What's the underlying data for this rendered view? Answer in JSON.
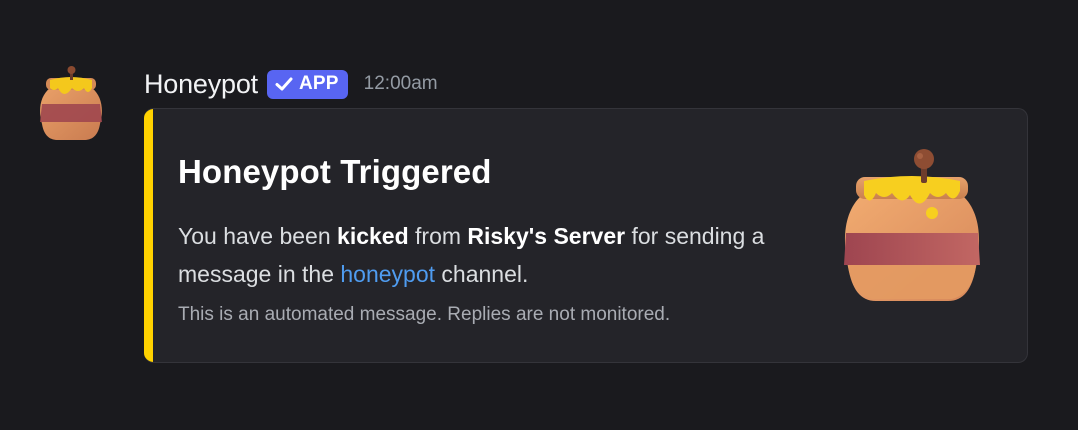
{
  "message": {
    "author": "Honeypot",
    "badge_label": "APP",
    "timestamp": "12:00am",
    "avatar_icon": "honey-pot-icon",
    "embed": {
      "accent_color": "#ffd200",
      "title": "Honeypot Triggered",
      "description": {
        "part1": "You have been ",
        "action": "kicked",
        "part2": " from ",
        "server": "Risky's Server",
        "part3": " for sending a message in the ",
        "channel": "honeypot",
        "part4": " channel."
      },
      "footer": "This is an automated message. Replies are not monitored.",
      "thumbnail_icon": "honey-pot-icon"
    }
  },
  "colors": {
    "background": "#1a1a1e",
    "embed_background": "#242429",
    "badge": "#5865f2",
    "link": "#4f9cf0"
  }
}
